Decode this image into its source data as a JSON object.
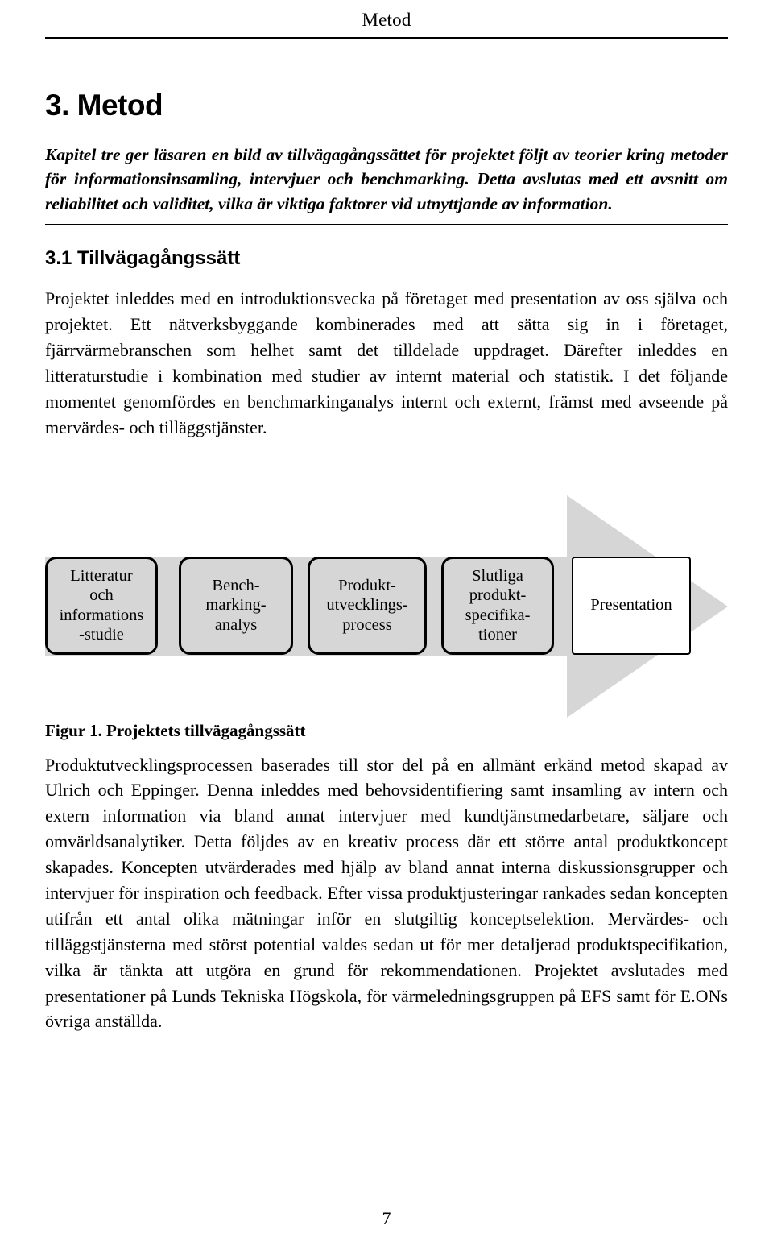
{
  "running_header": {
    "text": "Metod"
  },
  "chapter": {
    "title": "3. Metod",
    "intro": "Kapitel tre ger läsaren en bild av tillvägagångssättet för projektet följt av teorier kring metoder för informationsinsamling, intervjuer och benchmarking. Detta avslutas med ett avsnitt om reliabilitet och validitet, vilka är viktiga faktorer vid utnyttjande av information."
  },
  "section": {
    "heading": "3.1 Tillvägagångssätt",
    "paragraph_1": "Projektet inleddes med en introduktionsvecka på företaget med presentation av oss själva och projektet.  Ett nätverksbyggande kombinerades med att sätta sig in i företaget, fjärrvärmebranschen som helhet samt det tilldelade uppdraget.  Därefter inleddes en litteraturstudie i kombination med studier av internt material och statistik.  I det följande momentet genomfördes en benchmarkinganalys internt och externt, främst med avseende på mervärdes- och tilläggstjänster."
  },
  "figure": {
    "caption_label": "Figur 1.",
    "caption_text": "Projektets tillvägagångssätt",
    "boxes": [
      {
        "lines": [
          "Litteratur",
          "och",
          "informations",
          "-studie"
        ]
      },
      {
        "lines": [
          "Bench-",
          "marking-",
          "analys"
        ]
      },
      {
        "lines": [
          "Produkt-",
          "utvecklings-",
          "process"
        ]
      },
      {
        "lines": [
          "Slutliga",
          "produkt-",
          "specifika-",
          "tioner"
        ]
      },
      {
        "lines": [
          "Presentation"
        ]
      }
    ],
    "arrow_fill": "#d6d6d6",
    "box_fill": "#d6d6d6",
    "box_border": "#000000"
  },
  "body": {
    "paragraph_2": "Produktutvecklingsprocessen baserades till stor del på en allmänt erkänd metod skapad av Ulrich och Eppinger.  Denna inleddes med behovsidentifiering samt insamling av intern och extern information via bland annat intervjuer med kundtjänstmedarbetare, säljare och omvärldsanalytiker. Detta följdes av en kreativ process där ett större antal produktkoncept skapades.  Koncepten utvärderades med hjälp av bland annat interna diskussionsgrupper och intervjuer för inspiration och feedback.  Efter vissa produktjusteringar rankades sedan koncepten utifrån ett antal olika mätningar inför en slutgiltig konceptselektion.  Mervärdes- och tilläggstjänsterna med störst potential valdes sedan ut för mer detaljerad produktspecifikation, vilka är tänkta att utgöra en grund för rekommendationen.  Projektet avslutades med presentationer på Lunds Tekniska Högskola, för värmeledningsgruppen på EFS samt för E.ONs övriga anställda."
  },
  "page_number": "7"
}
